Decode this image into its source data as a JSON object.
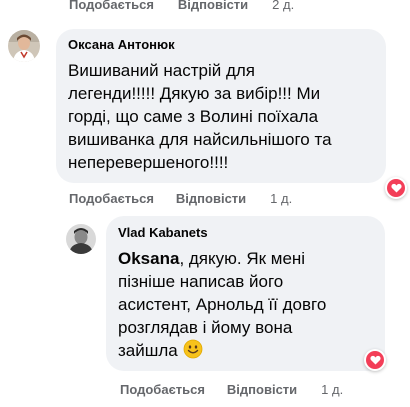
{
  "top_actions": {
    "like": "Подобається",
    "reply": "Відповісти",
    "time": "2 д."
  },
  "comment1": {
    "author": "Оксана Антонюк",
    "lines": [
      "Вишиваний настрій для",
      "легенди!!!!! Дякую за вибір!!! Ми",
      "горді, що саме з Волині поїхала",
      "вишиванка для найсильнішого та",
      "неперевершеного!!!!"
    ],
    "reaction": "heart",
    "actions": {
      "like": "Подобається",
      "reply": "Відповісти",
      "time": "1 д."
    }
  },
  "comment2": {
    "author": "Vlad Kabanets",
    "mention": "Oksana",
    "line1_rest": ", дякую. Як мені",
    "lines": [
      "пізніше написав його",
      "асистент, Арнольд її довго",
      "розглядав і йому вона",
      "зайшла"
    ],
    "emoji": "smiley",
    "reaction": "heart",
    "actions": {
      "like": "Подобається",
      "reply": "Відповісти",
      "time": "1 д."
    }
  },
  "colors": {
    "bubble": "#f0f2f5",
    "meta": "#65676b",
    "heart_bg": "#f33e58"
  }
}
